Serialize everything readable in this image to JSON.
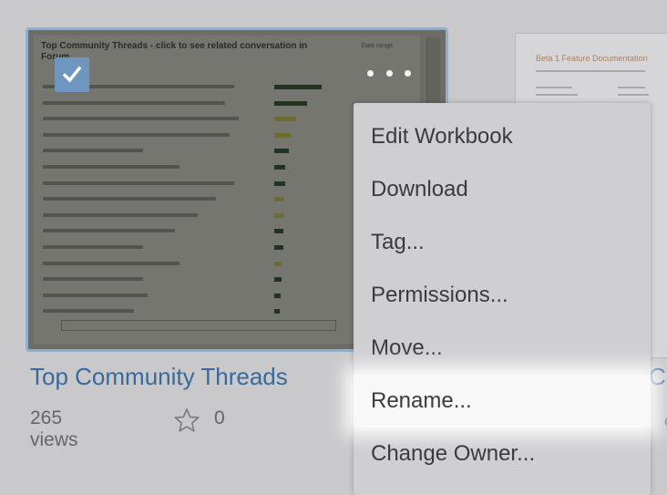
{
  "workbook1": {
    "title": "Top Community Threads",
    "views": "265 views",
    "favorites": "0",
    "thumbnail_title": "Top Community Threads - click to see related conversation in Forum",
    "thumbnail_filter": "Date range",
    "selected": true
  },
  "workbook2": {
    "title_fragment": "Co",
    "thumbnail_title": "Beta 1 Feature Documentation"
  },
  "menu": {
    "items": [
      {
        "label": "Edit Workbook"
      },
      {
        "label": "Download"
      },
      {
        "label": "Tag..."
      },
      {
        "label": "Permissions..."
      },
      {
        "label": "Move..."
      },
      {
        "label": "Rename..."
      },
      {
        "label": "Change Owner..."
      }
    ],
    "highlighted": "Rename..."
  },
  "colors": {
    "accent": "#386a9a",
    "checkbox": "#6e96be",
    "menu_bg": "#cfcfd1",
    "highlight": "#f8f8f8"
  }
}
